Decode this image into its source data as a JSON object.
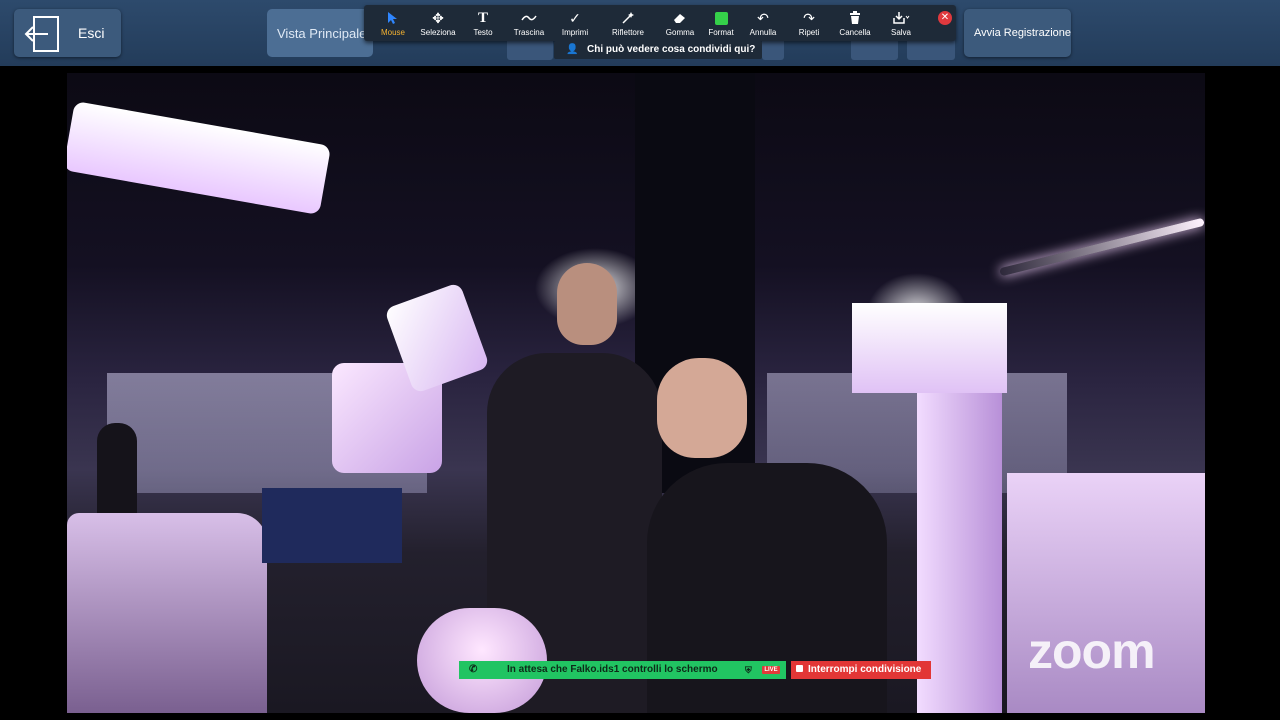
{
  "topbar": {
    "exit_label": "Esci",
    "view_label": "Vista Principale",
    "record_label": "Avvia Registrazione"
  },
  "annotation_toolbar": {
    "tools": [
      {
        "label": "Mouse",
        "icon": "mouse-pointer-icon",
        "active": true
      },
      {
        "label": "Seleziona",
        "icon": "move-icon"
      },
      {
        "label": "Testo",
        "icon": "text-icon"
      },
      {
        "label": "Trascina",
        "icon": "draw-icon"
      },
      {
        "label": "Imprimi",
        "icon": "stamp-check-icon"
      },
      {
        "label": "Riflettore",
        "icon": "spotlight-icon"
      },
      {
        "label": "Gomma",
        "icon": "eraser-icon"
      },
      {
        "label": "Format",
        "icon": "format-color-icon",
        "color": "#35d04a"
      },
      {
        "label": "Annulla",
        "icon": "undo-icon"
      },
      {
        "label": "Ripeti",
        "icon": "redo-icon"
      },
      {
        "label": "Cancella",
        "icon": "trash-icon"
      },
      {
        "label": "Salva",
        "icon": "save-icon"
      }
    ],
    "close_icon": "close-icon"
  },
  "share_info": {
    "label": "Chi può vedere cosa condividi qui?"
  },
  "status_bar": {
    "waiting_text": "In attesa che Falko.ids1 controlli lo schermo",
    "live_badge": "LIVE",
    "stop_label": "Interrompi condivisione",
    "colors": {
      "status": "#21c462",
      "stop": "#e23636"
    }
  },
  "watermark": {
    "text": "zoom"
  },
  "colors": {
    "topbar": "#2a4566",
    "toolbar": "#1e2a38",
    "active_tool": "#f5b230"
  }
}
